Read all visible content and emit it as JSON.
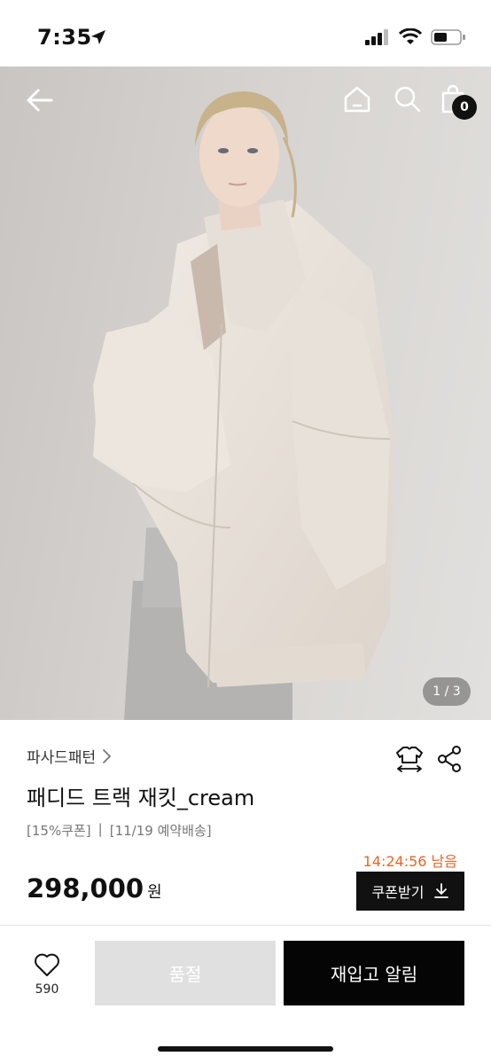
{
  "status_bar": {
    "time": "7:35",
    "icons": [
      "location-arrow-icon",
      "cellular-signal-icon",
      "wifi-icon",
      "battery-icon"
    ]
  },
  "nav": {
    "cart_count": "0",
    "icons": [
      "back-arrow-icon",
      "home-icon",
      "search-icon",
      "shopping-bag-icon"
    ]
  },
  "gallery": {
    "indicator": "1 / 3",
    "current": 1,
    "total": 3
  },
  "product": {
    "brand": "파사드패턴",
    "title": "패디드 트랙 재킷_cream",
    "coupon_tag": "[15%쿠폰]",
    "separator": "|",
    "delivery_tag": "[11/19 예약배송]",
    "timer": "14:24:56 남음",
    "price": "298,000",
    "currency": "원",
    "coupon_button": "쿠폰받기"
  },
  "bottom_bar": {
    "like_count": "590",
    "soldout_label": "품절",
    "restock_label": "재입고 알림"
  },
  "colors": {
    "accent_timer": "#e8662a",
    "primary": "#111111",
    "disabled": "#e0e0e0"
  }
}
